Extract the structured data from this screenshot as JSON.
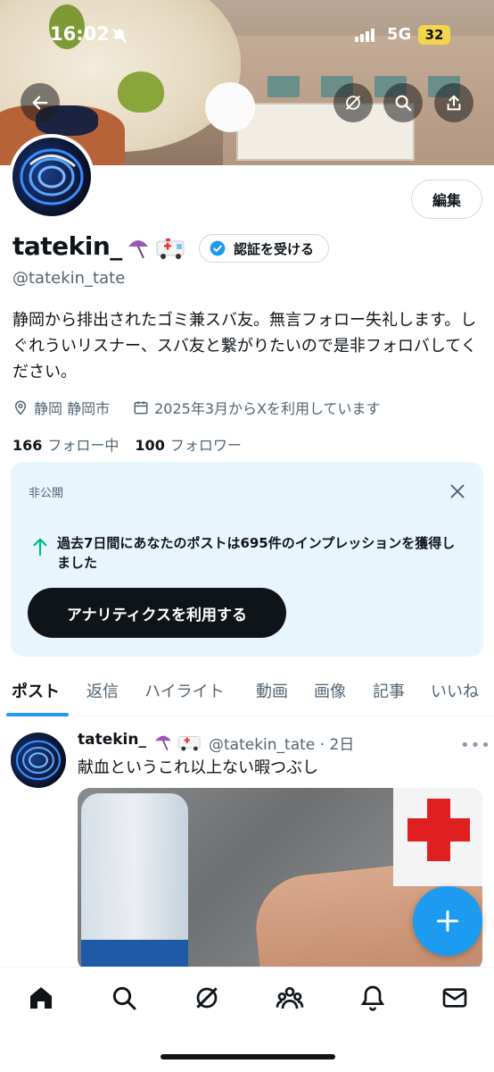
{
  "status_bar": {
    "time": "16:02",
    "network": "5G",
    "battery": "32"
  },
  "profile": {
    "name": "tatekin_",
    "handle": "@tatekin_tate",
    "edit_label": "編集",
    "verify_label": "認証を受ける",
    "bio": "静岡から排出されたゴミ兼スバ友。無言フォロー失礼します。しぐれういリスナー、スバ友と繋がりたいので是非フォロバしてください。",
    "location": "静岡 静岡市",
    "joined": "2025年3月からXを利用しています",
    "following_count": "166",
    "following_label": "フォロー中",
    "followers_count": "100",
    "followers_label": "フォロワー"
  },
  "analytics_card": {
    "private_label": "非公開",
    "message": "過去7日間にあなたのポストは695件のインプレッションを獲得しました",
    "button_label": "アナリティクスを利用する"
  },
  "tabs": [
    "ポスト",
    "返信",
    "ハイライト",
    "動画",
    "画像",
    "記事",
    "いいね"
  ],
  "post": {
    "name": "tatekin_",
    "handle_time": "@tatekin_tate · 2日",
    "text": "献血というこれ以上ない暇つぶし"
  },
  "icons": {
    "back": "arrow-left-icon",
    "grok": "grok-icon",
    "search": "search-icon",
    "share": "share-icon",
    "location": "location-pin-icon",
    "calendar": "calendar-icon"
  },
  "colors": {
    "accent": "#1d9bf0",
    "text": "#0f1419",
    "muted": "#536471",
    "card_bg": "#e9f5fd"
  }
}
